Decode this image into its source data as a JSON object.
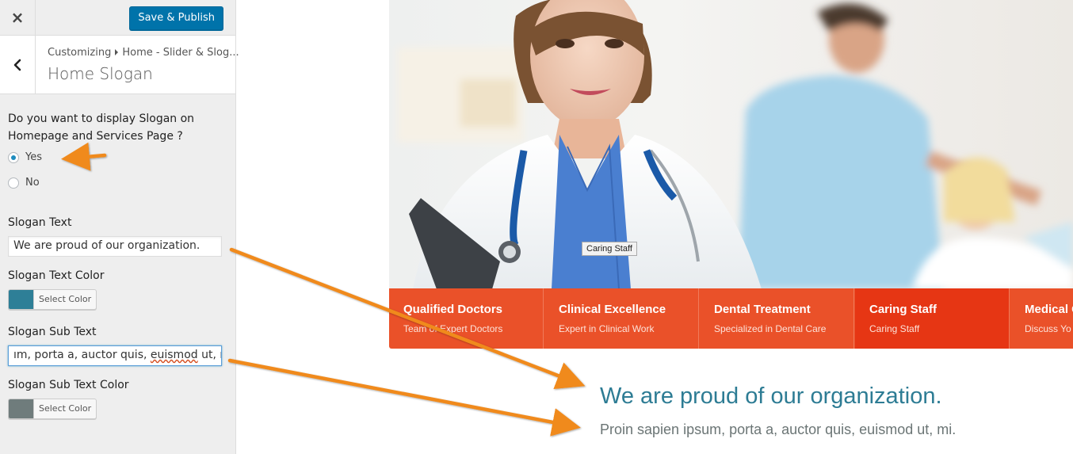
{
  "customizer": {
    "close_label": "×",
    "save_label": "Save & Publish",
    "breadcrumb_root": "Customizing",
    "breadcrumb_section": "Home - Slider & Slog...",
    "section_title": "Home Slogan",
    "display_question": "Do you want to display Slogan on Homepage and Services Page ?",
    "radio_options": [
      "Yes",
      "No"
    ],
    "radio_selected": "Yes",
    "slogan_text_label": "Slogan Text",
    "slogan_text_value": "We are proud of our organization.",
    "slogan_color_label": "Slogan Text Color",
    "slogan_color": "#2e7f97",
    "select_color_label": "Select Color",
    "slogan_sub_label": "Slogan Sub Text",
    "slogan_sub_value_visible_start": "ım, porta a, auctor quis, ",
    "slogan_sub_value_visible_misspelled": "euismod",
    "slogan_sub_value_visible_end": " ut, mi.",
    "slogan_sub_color_label": "Slogan Sub Text Color",
    "slogan_sub_color": "#6f7c7c"
  },
  "preview": {
    "tooltip": "Caring Staff",
    "features": [
      {
        "title": "Qualified Doctors",
        "subtitle": "Team of Expert Doctors"
      },
      {
        "title": "Clinical Excellence",
        "subtitle": "Expert in Clinical Work"
      },
      {
        "title": "Dental Treatment",
        "subtitle": "Specialized in Dental Care"
      },
      {
        "title": "Caring Staff",
        "subtitle": "Caring Staff"
      },
      {
        "title": "Medical C",
        "subtitle": "Discuss Yo"
      }
    ],
    "active_feature_index": 3,
    "slogan": "We are proud of our organization.",
    "slogan_sub": "Proin sapien ipsum, porta a, auctor quis, euismod ut, mi.",
    "feature_bar_color": "#ea5129",
    "annotation_arrow_color": "#f08a1c"
  }
}
